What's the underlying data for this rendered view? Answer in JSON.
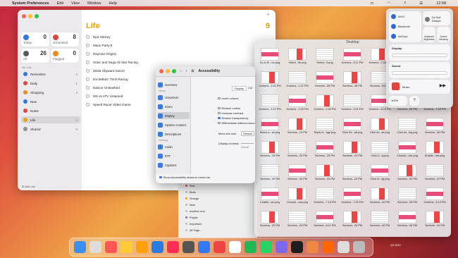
{
  "menubar": {
    "app": "System Preferences",
    "items": [
      "Edit",
      "View",
      "Window",
      "Help"
    ],
    "time": "12:58"
  },
  "reminders": {
    "smart": [
      {
        "label": "Today",
        "count": "0",
        "color": "#2f79e0"
      },
      {
        "label": "Scheduled",
        "count": "8",
        "color": "#e0463c"
      },
      {
        "label": "All",
        "count": "26",
        "color": "#5a5a5f"
      },
      {
        "label": "Flagged",
        "count": "0",
        "color": "#f08a1c"
      }
    ],
    "lists_header": "My Lists",
    "lists": [
      {
        "label": "Reminders",
        "count": "2",
        "color": "#2f79e0"
      },
      {
        "label": "Daily",
        "count": "1",
        "color": "#e0463c"
      },
      {
        "label": "Shopping",
        "count": "4",
        "color": "#f08a1c"
      },
      {
        "label": "New",
        "count": "",
        "color": "#2f79e0"
      },
      {
        "label": "Notes",
        "count": "",
        "color": "#e0463c"
      },
      {
        "label": "Life",
        "count": "9",
        "color": "#e9a100"
      },
      {
        "label": "Shared",
        "count": "0",
        "color": "#8e8e93"
      }
    ],
    "add_list": "Add List",
    "title": "Life",
    "count": "9",
    "tasks": [
      "Epic Mickey",
      "Mario Party 8",
      "Rayman Origins",
      "Sonic and Sega All Star Racing",
      "Zelda Skyward Sword",
      "ExciteBots: Trick Racing",
      "Nascar Unleashed",
      "MX vs ATV Untamed",
      "Speed Racer Video Game"
    ]
  },
  "accessibility": {
    "title": "Accessibility",
    "items": [
      "Overview",
      "VoiceOver",
      "Zoom",
      "Display",
      "Spoken Content",
      "Descriptions",
      "Audio",
      "RTT",
      "Captions"
    ],
    "headers": [
      "Vision",
      "Hearing"
    ],
    "tabs": [
      "Display",
      "Cur"
    ],
    "options": [
      "Invert colours",
      "Reduce motion",
      "Increase contrast",
      "Reduce transparency",
      "Differentiate without colour"
    ],
    "menubar_size_label": "Menu bar size:",
    "menubar_size_value": "Default",
    "contrast_label": "Display contrast:",
    "contrast_value": "Normal",
    "show_status": "Show Accessibility status in menu bar"
  },
  "desktop": {
    "title": "Desktop",
    "rows": [
      [
        "Do-in El...ics.png",
        "Select...ith.png",
        "Select...9.png",
        "Screens...8.11 PM",
        "Screens...2.34 PM",
        "Screens...4.58 PM",
        "Screens...2.58 PM"
      ],
      [
        "Screens...3.41 PM",
        "Screens...2.37 PM",
        "Screens...56 PM",
        "Screens...38 PM",
        "Screens...54 PM",
        "Screens...41 PM",
        "Screens...56 PM"
      ],
      [
        "Screens...4.21 PM",
        "Screens...2.33 PM",
        "Screens...2.52 PM",
        "Screens...9.01 PM",
        "Screens...8.22 PM",
        "Screens...53 PM",
        "Screens...7.63 PM"
      ],
      [
        "Select a...ab.png",
        "Screens...24 PM",
        "Reply to...age.png",
        "Click Se...ab.png",
        "Click se...ab.png",
        "Click an...ing.png",
        "Screens...40 PM"
      ],
      [
        "Screens...35 PM",
        "Screens...20 PM",
        "Screens...29 PM",
        "Screens...24 PM",
        "Click O...ly.png",
        "Choose...ose.png",
        "Enable...ess.png"
      ],
      [
        "Screens...20 PM",
        "Screens...40 PM",
        "Screens...24 PM",
        "Screens...24 PM",
        "Click th...ng.png",
        "Screens...30 PM",
        "Screens...07 PM"
      ],
      [
        "Enable...ion.png",
        "Choose...ose.png",
        "Screens...7.16 PM",
        "Screens...7.02 PM",
        "Screens...20 PM",
        "Screens...05 PM",
        "Screens...6.14 PM"
      ],
      [
        "Screens...20 PM",
        "Screens...20 PM",
        "Screens...8.11 PM",
        "Screens...20 PM",
        "Screens...42 PM",
        "Screens...06 PM",
        "Screens...24 PM"
      ]
    ]
  },
  "control_centre": {
    "wifi": "Wi-Fi",
    "bluetooth": "Bluetooth",
    "airdrop": "AirDrop",
    "dnd": "Do Not Disturb",
    "kb": "Keyboard Brightness",
    "mirroring": "Screen Mirroring",
    "display": "Display",
    "sound": "Sound",
    "music": "Music",
    "battery": "100%"
  },
  "bottomlist": [
    "Red",
    "Beds",
    "Orange",
    "New",
    "Another one",
    "Purple",
    "Important",
    "All Tags..."
  ],
  "dock_note": "Q3 2020",
  "colors": {
    "accent": "#2a6ad6",
    "reminders": "#e9a100"
  }
}
